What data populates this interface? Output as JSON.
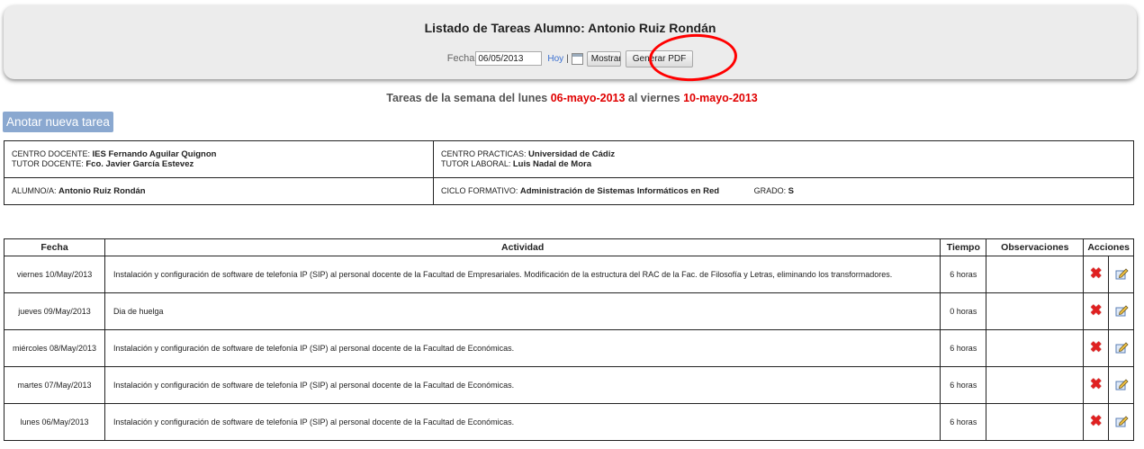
{
  "header": {
    "title": "Listado de Tareas Alumno: Antonio Ruiz Rondán",
    "date_label": "Fecha",
    "date_value": "06/05/2013",
    "today_link": "Hoy",
    "separator": "|",
    "show_button": "Mostrar",
    "pdf_button": "Generar PDF"
  },
  "week": {
    "prefix": "Tareas de la semana del lunes ",
    "start": "06-mayo-2013",
    "middle": " al viernes ",
    "end": "10-mayo-2013"
  },
  "new_task_button": "Anotar nueva tarea",
  "info": {
    "centro_docente_label": "CENTRO DOCENTE:",
    "centro_docente": "IES Fernando Aguilar Quignon",
    "tutor_docente_label": "TUTOR DOCENTE:",
    "tutor_docente": "Fco. Javier García Estevez",
    "centro_practicas_label": "CENTRO PRACTICAS:",
    "centro_practicas": "Universidad de Cádiz",
    "tutor_laboral_label": "TUTOR LABORAL:",
    "tutor_laboral": "Luis Nadal de Mora",
    "alumno_label": "ALUMNO/A:",
    "alumno": "Antonio Ruiz Rondán",
    "ciclo_label": "CICLO FORMATIVO:",
    "ciclo": "Administración de Sistemas Informáticos en Red",
    "grado_label": "GRADO:",
    "grado": "S"
  },
  "tasks": {
    "headers": [
      "Fecha",
      "Actividad",
      "Tiempo",
      "Observaciones",
      "Acciones"
    ],
    "rows": [
      {
        "fecha": "viernes 10/May/2013",
        "actividad": "Instalación y configuración de software de telefonía IP (SIP) al personal docente de la Facultad de Empresariales. Modificación de la estructura del RAC de la Fac. de Filosofía y Letras, eliminando los transformadores.",
        "tiempo": "6 horas",
        "observaciones": ""
      },
      {
        "fecha": "jueves 09/May/2013",
        "actividad": "Dia de huelga",
        "tiempo": "0 horas",
        "observaciones": ""
      },
      {
        "fecha": "miércoles 08/May/2013",
        "actividad": "Instalación y configuración de software de telefonía IP (SIP) al personal docente de la Facultad de Económicas.",
        "tiempo": "6 horas",
        "observaciones": ""
      },
      {
        "fecha": "martes 07/May/2013",
        "actividad": "Instalación y configuración de software de telefonía IP (SIP) al personal docente de la Facultad de Económicas.",
        "tiempo": "6 horas",
        "observaciones": ""
      },
      {
        "fecha": "lunes 06/May/2013",
        "actividad": "Instalación y configuración de software de telefonía IP (SIP) al personal docente de la Facultad de Económicas.",
        "tiempo": "6 horas",
        "observaciones": ""
      }
    ]
  },
  "colors": {
    "accent_red": "#e00000",
    "new_task_button": "#8aa8d0",
    "link": "#3a6fd0"
  },
  "icons": {
    "calendar": "calendar-icon",
    "delete": "delete-icon",
    "edit": "edit-icon"
  }
}
